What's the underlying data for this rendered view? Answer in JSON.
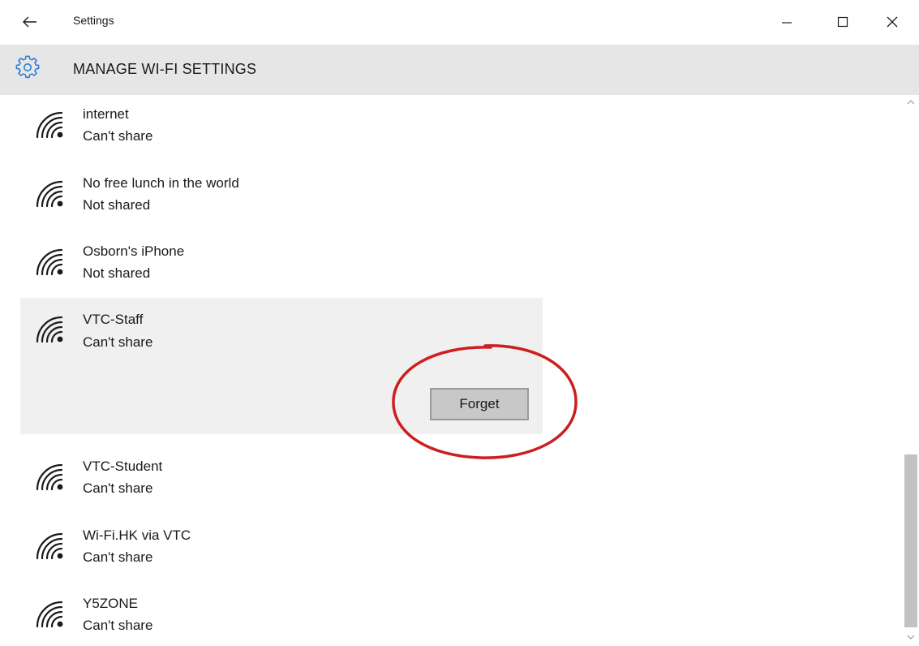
{
  "window": {
    "title": "Settings"
  },
  "header": {
    "title": "MANAGE WI-FI SETTINGS",
    "icon": "gear-icon",
    "accent_color": "#2d7dd2"
  },
  "networks": [
    {
      "name": "internet",
      "status": "Can't share"
    },
    {
      "name": "No free lunch in the world",
      "status": "Not shared"
    },
    {
      "name": "Osborn's iPhone",
      "status": "Not shared"
    },
    {
      "name": "VTC-Staff",
      "status": "Can't share",
      "expanded": true
    },
    {
      "name": "VTC-Student",
      "status": "Can't share"
    },
    {
      "name": "Wi-Fi.HK via VTC",
      "status": "Can't share"
    },
    {
      "name": "Y5ZONE",
      "status": "Can't share"
    }
  ],
  "actions": {
    "forget_label": "Forget"
  },
  "annotation": {
    "color": "#cc1f1f"
  },
  "icons": {
    "network": "wifi-icon",
    "back": "back-arrow-icon",
    "minimize": "minimize-icon",
    "maximize": "maximize-icon",
    "close": "close-icon"
  }
}
